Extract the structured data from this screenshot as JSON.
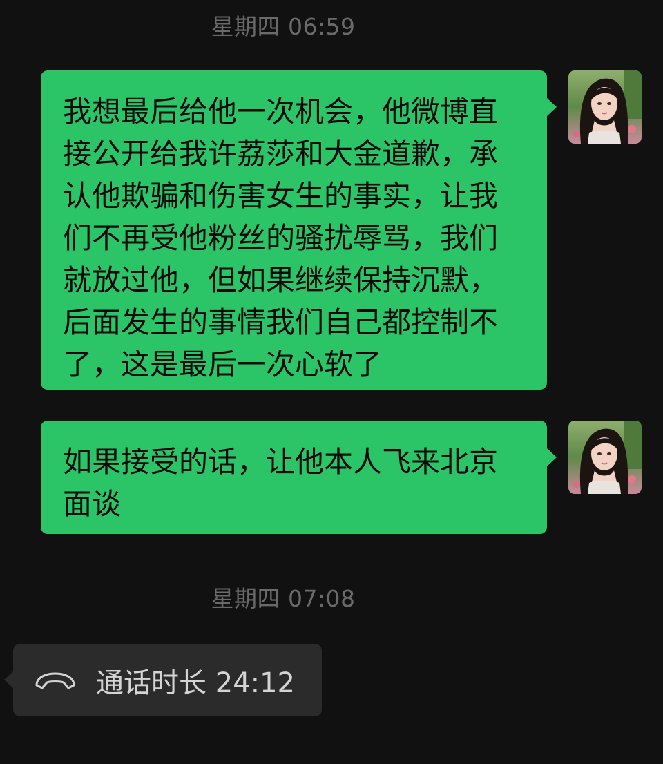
{
  "chat": {
    "timestamps": [
      {
        "text": "星期四 06:59"
      },
      {
        "text": "星期四 07:08"
      }
    ],
    "messages": [
      {
        "sender": "self",
        "text": "我想最后给他一次机会，他微博直接公开给我许荔莎和大金道歉，承认他欺骗和伤害女生的事实，让我们不再受他粉丝的骚扰辱骂，我们就放过他，但如果继续保持沉默，后面发生的事情我们自己都控制不了，这是最后一次心软了"
      },
      {
        "sender": "self",
        "text": "如果接受的话，让他本人飞来北京面谈"
      }
    ],
    "call": {
      "icon": "phone-hangup-icon",
      "text": "通话时长 24:12"
    }
  },
  "colors": {
    "background": "#111111",
    "outgoing_bubble": "#2bc467",
    "incoming_bubble": "#2b2b2b",
    "timestamp_text": "#6a6a6a"
  }
}
